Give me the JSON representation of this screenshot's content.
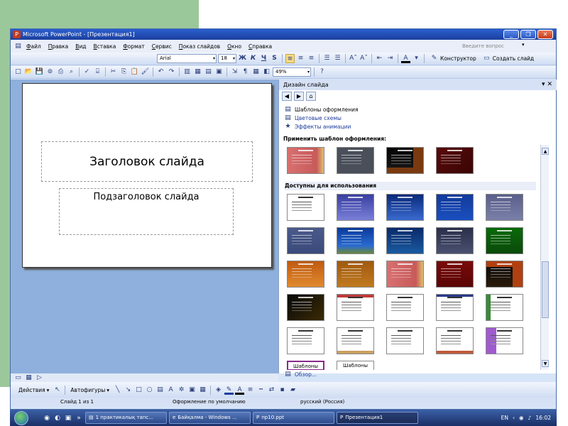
{
  "window": {
    "title": "Microsoft PowerPoint - [Презентация1]",
    "controls": [
      "minimize-icon",
      "restore-icon",
      "close-icon"
    ]
  },
  "menu": {
    "items": [
      "Файл",
      "Правка",
      "Вид",
      "Вставка",
      "Формат",
      "Сервис",
      "Показ слайдов",
      "Окно",
      "Справка"
    ],
    "ask_placeholder": "Введите вопрос"
  },
  "format_toolbar": {
    "font": "Arial",
    "size": "18",
    "bold": "Ж",
    "italic": "К",
    "underline": "Ч",
    "shadow": "S",
    "designer": "Конструктор",
    "new_slide": "Создать слайд"
  },
  "standard_toolbar": {
    "zoom": "49%"
  },
  "slide": {
    "title": "Заголовок слайда",
    "subtitle": "Подзаголовок слайда"
  },
  "task_pane": {
    "title": "Дизайн слайда",
    "links": [
      "Шаблоны оформления",
      "Цветовые схемы",
      "Эффекты анимации"
    ],
    "applied_heading": "Применить шаблон оформления:",
    "available_heading": "Доступны для использования",
    "browse": "Обзор...",
    "thumb_captions": [
      "Шаблоны",
      "Шаблоны"
    ]
  },
  "drawing_toolbar": {
    "actions": "Действия",
    "autoshapes": "Автофигуры"
  },
  "status": {
    "slide_counter": "Слайд 1 из 1",
    "design": "Оформление по умолчанию",
    "language": "русский (Россия)"
  },
  "taskbar": {
    "tasks": [
      "1 практикалық тапс...",
      "Байқалма - Windows ...",
      "пр10.ppt",
      "Презентация1"
    ],
    "lang": "EN",
    "clock": "16:02"
  },
  "colors": {
    "title_bar": "#1c3f9e",
    "workspace": "#8fb0dc",
    "accent_green": "#9ac89a"
  }
}
